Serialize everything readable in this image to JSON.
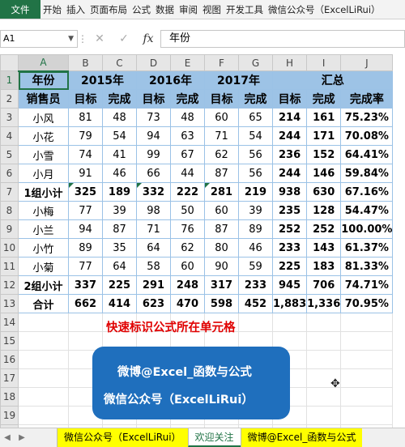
{
  "ribbon": {
    "tabs": [
      "文件",
      "开始",
      "插入",
      "页面布局",
      "公式",
      "数据",
      "审阅",
      "视图",
      "开发工具",
      "微信公众号（ExcelLiRui）"
    ]
  },
  "formula_bar": {
    "name_box": "A1",
    "content": "年份"
  },
  "columns": [
    "A",
    "B",
    "C",
    "D",
    "E",
    "F",
    "G",
    "H",
    "I",
    "J"
  ],
  "rows": [
    "1",
    "2",
    "3",
    "4",
    "5",
    "6",
    "7",
    "8",
    "9",
    "10",
    "11",
    "12",
    "13",
    "14",
    "15",
    "16",
    "17",
    "18",
    "19",
    "20"
  ],
  "table": {
    "row1": {
      "a": "年份",
      "y2015": "2015年",
      "y2016": "2016年",
      "y2017": "2017年",
      "total": "汇总"
    },
    "row2": [
      "销售员",
      "目标",
      "完成",
      "目标",
      "完成",
      "目标",
      "完成",
      "目标",
      "完成",
      "完成率"
    ],
    "data": [
      [
        "小风",
        "81",
        "48",
        "73",
        "48",
        "60",
        "65",
        "214",
        "161",
        "75.23%"
      ],
      [
        "小花",
        "79",
        "54",
        "94",
        "63",
        "71",
        "54",
        "244",
        "171",
        "70.08%"
      ],
      [
        "小雪",
        "74",
        "41",
        "99",
        "67",
        "62",
        "56",
        "236",
        "152",
        "64.41%"
      ],
      [
        "小月",
        "91",
        "46",
        "66",
        "44",
        "87",
        "56",
        "244",
        "146",
        "59.84%"
      ],
      [
        "1组小计",
        "325",
        "189",
        "332",
        "222",
        "281",
        "219",
        "938",
        "630",
        "67.16%"
      ],
      [
        "小梅",
        "77",
        "39",
        "98",
        "50",
        "60",
        "39",
        "235",
        "128",
        "54.47%"
      ],
      [
        "小兰",
        "94",
        "87",
        "71",
        "76",
        "87",
        "89",
        "252",
        "252",
        "100.00%"
      ],
      [
        "小竹",
        "89",
        "35",
        "64",
        "62",
        "80",
        "46",
        "233",
        "143",
        "61.37%"
      ],
      [
        "小菊",
        "77",
        "64",
        "58",
        "60",
        "90",
        "59",
        "225",
        "183",
        "81.33%"
      ],
      [
        "2组小计",
        "337",
        "225",
        "291",
        "248",
        "317",
        "233",
        "945",
        "706",
        "74.71%"
      ],
      [
        "合计",
        "662",
        "414",
        "623",
        "470",
        "598",
        "452",
        "1,883",
        "1,336",
        "70.95%"
      ]
    ]
  },
  "note": "快速标识公式所在单元格",
  "banner": {
    "line1": "微博@Excel_函数与公式",
    "line2": "微信公众号（ExcelLiRui）"
  },
  "sheet_tabs": [
    "微信公众号（ExcelLiRui）",
    "欢迎关注",
    "微博@Excel_函数与公式"
  ],
  "colors": {
    "header_fill": "#9dc3e6",
    "accent": "#217346",
    "note": "#e00000",
    "banner": "#1f6fbd",
    "tab_highlight": "#ffff00"
  }
}
